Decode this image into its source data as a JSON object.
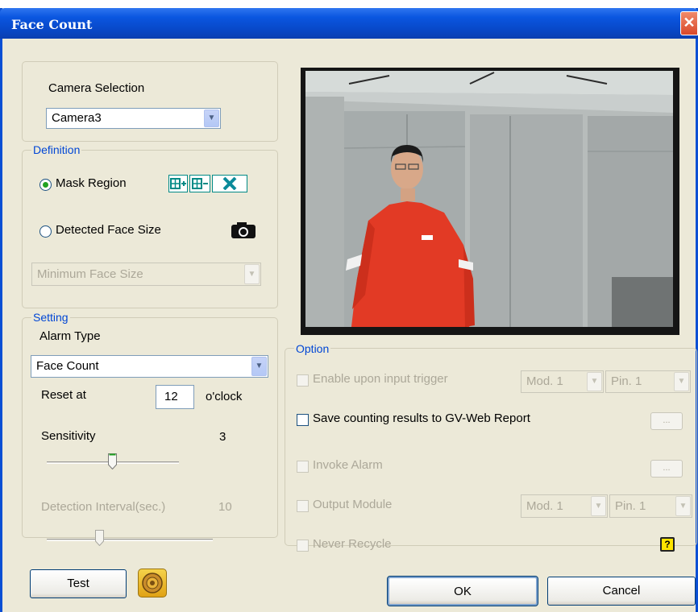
{
  "window": {
    "title": "Face Count",
    "close_glyph": "✕"
  },
  "camera_selection": {
    "label": "Camera Selection",
    "value": "Camera3"
  },
  "definition": {
    "legend": "Definition",
    "mask_region": {
      "label": "Mask Region",
      "selected": true
    },
    "detected_face_size": {
      "label": "Detected Face Size",
      "selected": false
    },
    "face_size_combo": "Minimum Face Size"
  },
  "setting": {
    "legend": "Setting",
    "alarm_type_label": "Alarm Type",
    "alarm_type_value": "Face Count",
    "reset_at_label": "Reset at",
    "reset_at_value": "12",
    "reset_at_suffix": "o'clock",
    "sensitivity_label": "Sensitivity",
    "sensitivity_value": "3",
    "detection_interval_label": "Detection Interval(sec.)",
    "detection_interval_value": "10"
  },
  "option": {
    "legend": "Option",
    "enable_input_trigger": "Enable upon input trigger",
    "mod1": "Mod. 1",
    "pin1": "Pin. 1",
    "save_results": "Save counting results to GV-Web Report",
    "invoke_alarm": "Invoke Alarm",
    "output_module": "Output Module",
    "never_recycle": "Never Recycle",
    "ellipsis": "...",
    "help_glyph": "?"
  },
  "buttons": {
    "test": "Test",
    "ok": "OK",
    "cancel": "Cancel"
  },
  "colors": {
    "title_bar": "#0a56e0",
    "legend_text": "#0046d5",
    "jacket": "#e23a25"
  }
}
